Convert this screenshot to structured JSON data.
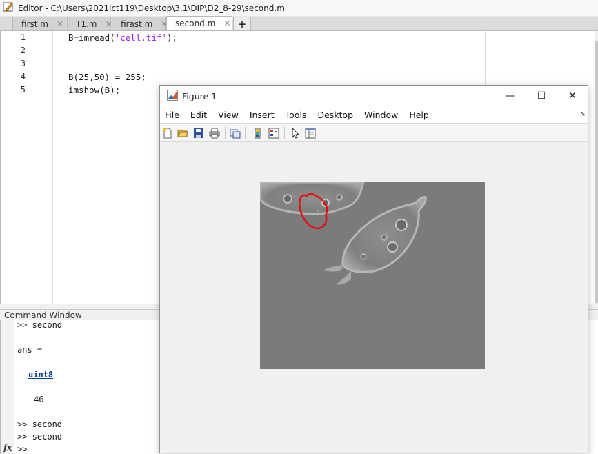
{
  "editor": {
    "title": "Editor - C:\\Users\\2021ict119\\Desktop\\3.1\\DIP\\D2_8-29\\second.m",
    "tabs": [
      {
        "label": "first.m"
      },
      {
        "label": "T1.m"
      },
      {
        "label": "firast.m"
      },
      {
        "label": "second.m",
        "active": true
      }
    ],
    "add_tab_label": "+",
    "line_numbers": [
      "1",
      "2",
      "3",
      "4",
      "5"
    ],
    "code": {
      "line1_pre": "B=imread(",
      "line1_str": "'cell.tif'",
      "line1_post": ");",
      "line4": "B(25,50) = 255;",
      "line5": "imshow(B);"
    }
  },
  "command_window": {
    "header": "Command Window",
    "lines": {
      "l1": ">> second",
      "l2": "ans =",
      "l3_link": "uint8",
      "l4": "46",
      "l5": ">> second",
      "l6": ">> second",
      "prompt": ">>"
    },
    "fx_label": "fx"
  },
  "figure": {
    "title": "Figure 1",
    "window_buttons": {
      "minimize": "—",
      "maximize": "☐",
      "close": "✕"
    },
    "menus": [
      "File",
      "Edit",
      "View",
      "Insert",
      "Tools",
      "Desktop",
      "Window",
      "Help"
    ],
    "toolbar_icons": [
      "new-figure-icon",
      "open-file-icon",
      "save-icon",
      "print-icon",
      "link-plot-icon",
      "colorbar-icon",
      "legend-icon",
      "pointer-icon",
      "property-inspector-icon"
    ],
    "colors": {
      "image_background": "#7b7b7b",
      "annotation": "#e01010"
    }
  }
}
